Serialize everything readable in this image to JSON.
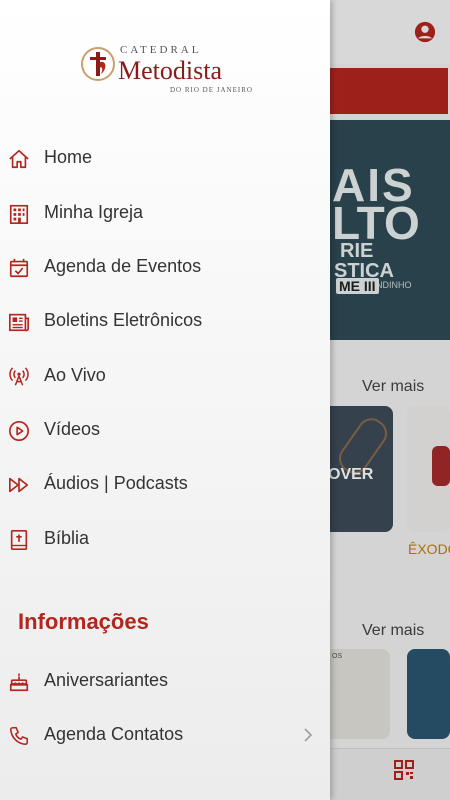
{
  "colors": {
    "accent": "#b3261e",
    "text": "#333333"
  },
  "logo": {
    "top": "CATEDRAL",
    "main": "Metodista",
    "sub": "DO RIO DE JANEIRO"
  },
  "menu": [
    {
      "label": "Home",
      "icon": "home-icon"
    },
    {
      "label": "Minha Igreja",
      "icon": "building-icon"
    },
    {
      "label": "Agenda de Eventos",
      "icon": "calendar-icon"
    },
    {
      "label": "Boletins Eletrônicos",
      "icon": "newspaper-icon"
    },
    {
      "label": "Ao Vivo",
      "icon": "broadcast-icon"
    },
    {
      "label": "Vídeos",
      "icon": "play-icon"
    },
    {
      "label": "Áudios | Podcasts",
      "icon": "fast-forward-icon"
    },
    {
      "label": "Bíblia",
      "icon": "bible-icon"
    }
  ],
  "info_section": {
    "title": "Informações",
    "items": [
      {
        "label": "Aniversariantes",
        "icon": "cake-icon"
      },
      {
        "label": "Agenda Contatos",
        "icon": "phone-icon"
      }
    ]
  },
  "background": {
    "banner_lines": [
      "AIS",
      "LTO",
      "RIE",
      "STICA",
      "ANDINHO",
      "ME III"
    ],
    "ver_mais_1": "Ver mais",
    "ver_mais_2": "Ver mais",
    "card1_text": "OVER",
    "card_caption": "ÊXODO",
    "card3_text": "OS"
  }
}
